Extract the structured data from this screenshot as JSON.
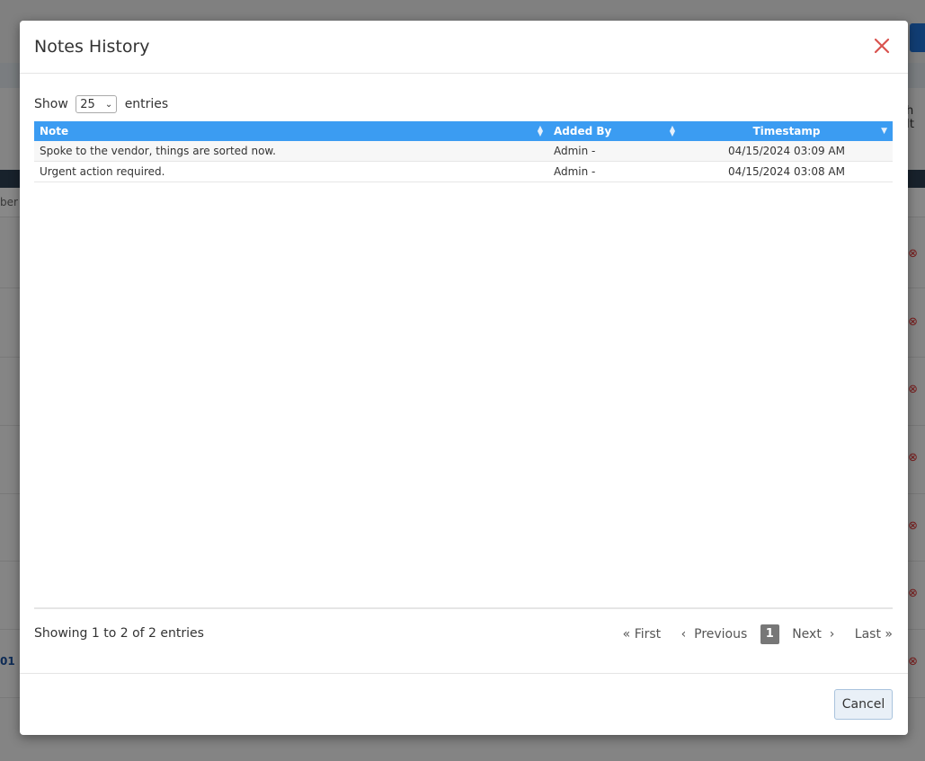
{
  "background": {
    "partial_text_right": "h It",
    "filter_text": "ber",
    "row_number": "01"
  },
  "modal": {
    "title": "Notes History",
    "length_menu": {
      "show_label": "Show",
      "selected": "25",
      "entries_label": "entries"
    },
    "table": {
      "columns": [
        {
          "label": "Note"
        },
        {
          "label": "Added By"
        },
        {
          "label": "Timestamp"
        }
      ],
      "rows": [
        {
          "note": "Spoke to the vendor, things are sorted now.",
          "added_by": "Admin -",
          "timestamp": "04/15/2024 03:09 AM"
        },
        {
          "note": "Urgent action required.",
          "added_by": "Admin -",
          "timestamp": "04/15/2024 03:08 AM"
        }
      ]
    },
    "info": "Showing 1 to 2 of 2 entries",
    "pagination": {
      "first": "First",
      "previous": "Previous",
      "current": "1",
      "next": "Next",
      "last": "Last"
    },
    "footer": {
      "cancel_label": "Cancel"
    }
  },
  "colors": {
    "header_blue": "#3b9cf2",
    "close_red": "#d9534f",
    "current_page": "#777777"
  }
}
